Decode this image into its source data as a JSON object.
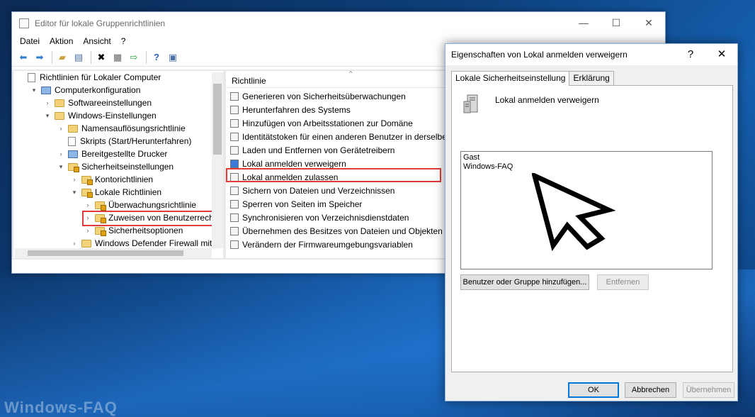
{
  "editor": {
    "title": "Editor für lokale Gruppenrichtlinien",
    "menu": [
      "Datei",
      "Aktion",
      "Ansicht",
      "?"
    ],
    "tree": [
      {
        "label": "Richtlinien für Lokaler Computer",
        "level": 0,
        "icon": "document-icon",
        "expander": ""
      },
      {
        "label": "Computerkonfiguration",
        "level": 1,
        "icon": "computer-icon",
        "expander": "▾"
      },
      {
        "label": "Softwareeinstellungen",
        "level": 2,
        "icon": "folder-icon",
        "expander": "›"
      },
      {
        "label": "Windows-Einstellungen",
        "level": 2,
        "icon": "folder-icon",
        "expander": "▾"
      },
      {
        "label": "Namensauflösungsrichtlinie",
        "level": 3,
        "icon": "folder-icon",
        "expander": "›"
      },
      {
        "label": "Skripts (Start/Herunterfahren)",
        "level": 3,
        "icon": "document-icon",
        "expander": ""
      },
      {
        "label": "Bereitgestellte Drucker",
        "level": 3,
        "icon": "printer-icon",
        "expander": "›"
      },
      {
        "label": "Sicherheitseinstellungen",
        "level": 3,
        "icon": "locked-folder-icon",
        "expander": "▾"
      },
      {
        "label": "Kontorichtlinien",
        "level": 4,
        "icon": "locked-folder-icon",
        "expander": "›"
      },
      {
        "label": "Lokale Richtlinien",
        "level": 4,
        "icon": "locked-folder-icon",
        "expander": "▾"
      },
      {
        "label": "Überwachungsrichtlinie",
        "level": 5,
        "icon": "locked-folder-icon",
        "expander": "›"
      },
      {
        "label": "Zuweisen von Benutzerrechten",
        "level": 5,
        "icon": "locked-folder-icon",
        "expander": "›"
      },
      {
        "label": "Sicherheitsoptionen",
        "level": 5,
        "icon": "locked-folder-icon",
        "expander": "›"
      },
      {
        "label": "Windows Defender Firewall mit er",
        "level": 4,
        "icon": "folder-icon",
        "expander": "›"
      }
    ],
    "list_header": "Richtlinie",
    "policies": [
      "Generieren von Sicherheitsüberwachungen",
      "Herunterfahren des Systems",
      "Hinzufügen von Arbeitsstationen zur Domäne",
      "Identitätstoken für einen anderen Benutzer in derselbe",
      "Laden und Entfernen von Gerätetreibern",
      "Lokal anmelden verweigern",
      "Lokal anmelden zulassen",
      "Sichern von Dateien und Verzeichnissen",
      "Sperren von Seiten im Speicher",
      "Synchronisieren von Verzeichnisdienstdaten",
      "Übernehmen des Besitzes von Dateien und Objekten",
      "Verändern der Firmwareumgebungsvariablen"
    ]
  },
  "dialog": {
    "title": "Eigenschaften von Lokal anmelden verweigern",
    "help": "?",
    "close": "✕",
    "tabs": [
      "Lokale Sicherheitseinstellung",
      "Erklärung"
    ],
    "heading": "Lokal anmelden verweigern",
    "entries": [
      "Gast",
      "Windows-FAQ"
    ],
    "add_button": "Benutzer oder Gruppe hinzufügen...",
    "remove_button": "Entfernen",
    "ok": "OK",
    "cancel": "Abbrechen",
    "apply": "Übernehmen"
  },
  "watermark": "Windows-FAQ",
  "colors": {
    "highlight": "#e03c3c",
    "accent": "#0078d7"
  }
}
